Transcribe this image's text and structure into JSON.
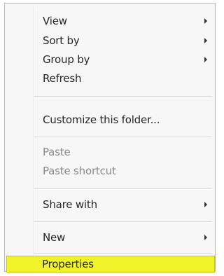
{
  "context_menu": {
    "items": [
      {
        "label": "View",
        "submenu": true,
        "enabled": true
      },
      {
        "label": "Sort by",
        "submenu": true,
        "enabled": true
      },
      {
        "label": "Group by",
        "submenu": true,
        "enabled": true
      },
      {
        "label": "Refresh",
        "submenu": false,
        "enabled": true
      },
      {
        "label": "Customize this folder...",
        "submenu": false,
        "enabled": true
      },
      {
        "label": "Paste",
        "submenu": false,
        "enabled": false
      },
      {
        "label": "Paste shortcut",
        "submenu": false,
        "enabled": false
      },
      {
        "label": "Share with",
        "submenu": true,
        "enabled": true
      },
      {
        "label": "New",
        "submenu": true,
        "enabled": true
      },
      {
        "label": "Properties",
        "submenu": false,
        "enabled": true,
        "highlighted": true
      }
    ],
    "highlight_color": "#f0f22a",
    "background_color": "#f7f7f7"
  }
}
